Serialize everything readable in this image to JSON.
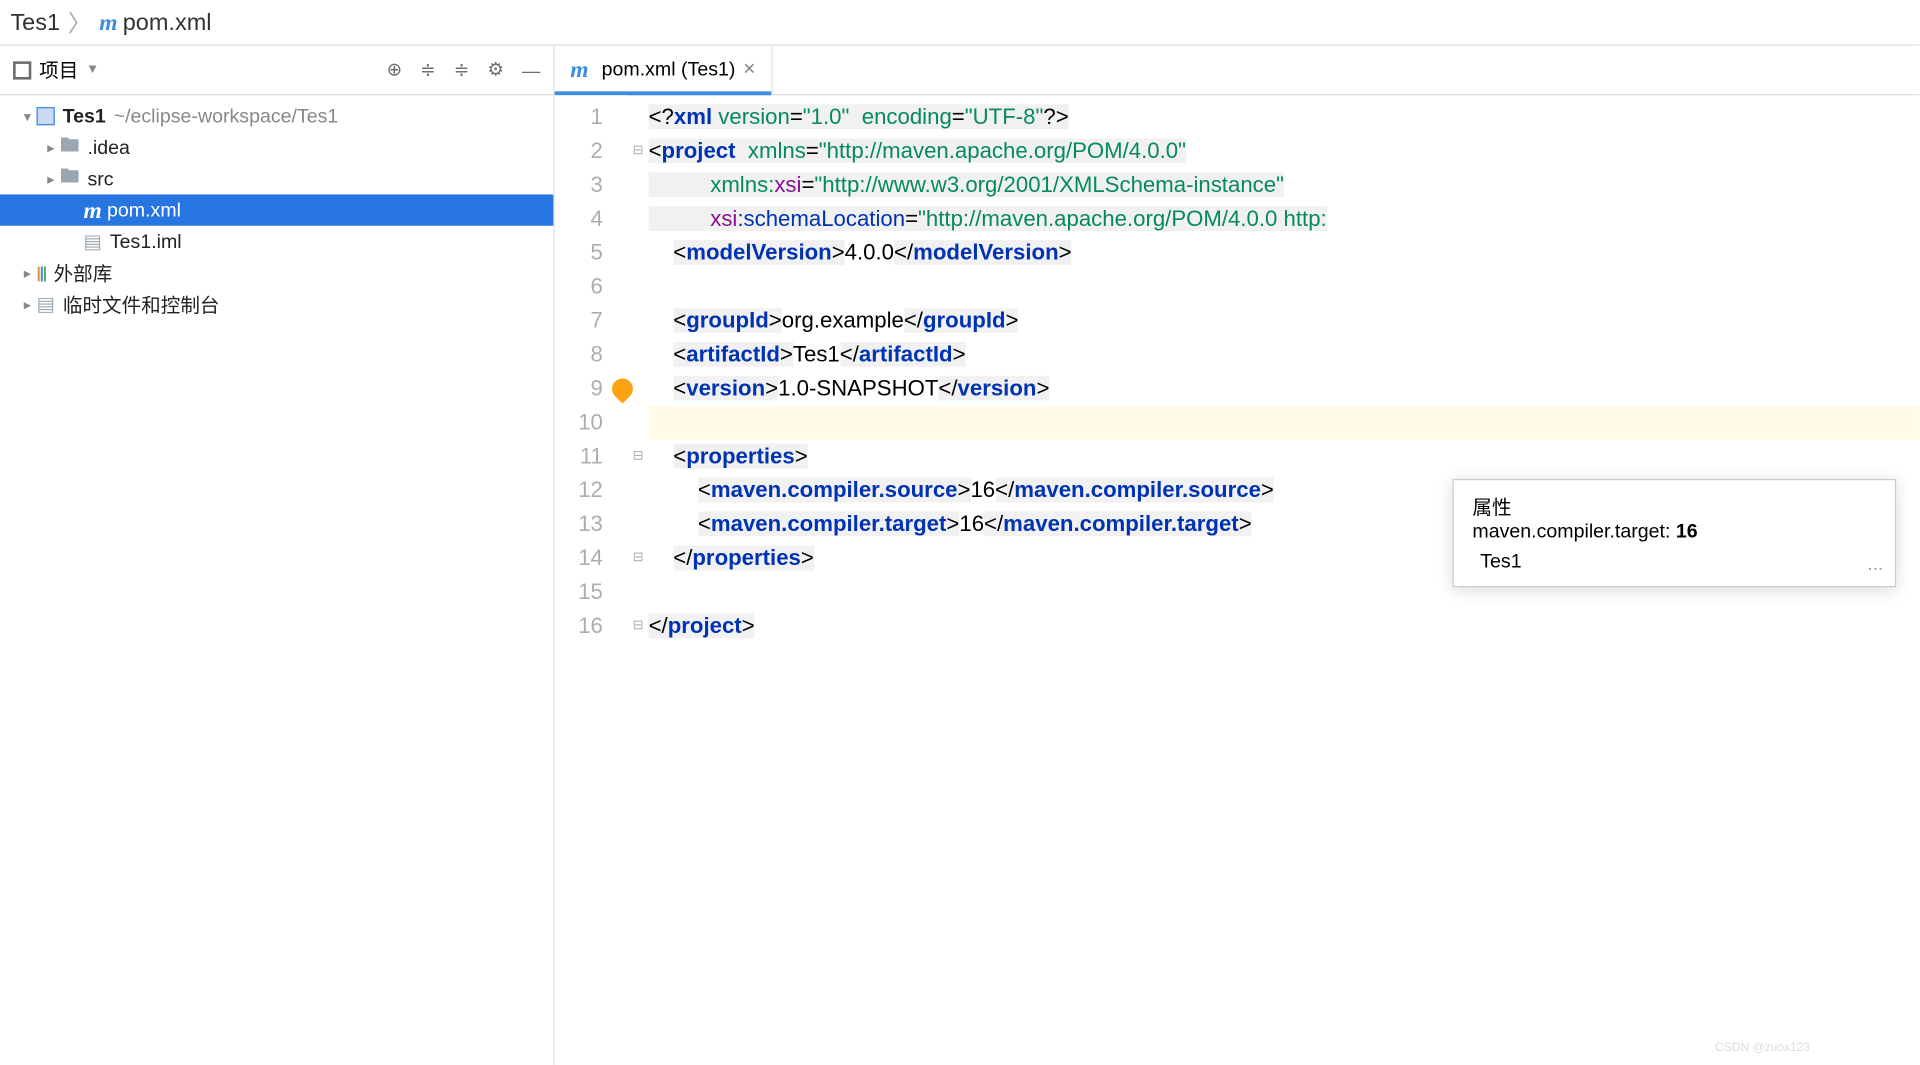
{
  "breadcrumb": {
    "project": "Tes1",
    "file": "pom.xml"
  },
  "sidebar": {
    "title": "项目",
    "tree": {
      "project": "Tes1",
      "project_path": "~/eclipse-workspace/Tes1",
      "idea": ".idea",
      "src": "src",
      "pom": "pom.xml",
      "iml": "Tes1.iml",
      "ext_lib": "外部库",
      "scratches": "临时文件和控制台"
    }
  },
  "tab": {
    "label": "pom.xml (Tes1)"
  },
  "code": {
    "xml_decl_open": "<?",
    "xml": "xml",
    "version_attr": "version",
    "version_val": "\"1.0\"",
    "encoding_attr": "encoding",
    "encoding_val": "\"UTF-8\"",
    "xml_decl_close": "?>",
    "project": "project",
    "xmlns_attr": "xmlns",
    "xmlns_val": "\"http://maven.apache.org/POM/4.0.0\"",
    "xsi_ns": "xmlns:",
    "xsi": "xsi",
    "xsi_val": "\"http://www.w3.org/2001/XMLSchema-instance\"",
    "xsi_pfx": "xsi",
    "schemaLoc": ":schemaLocation",
    "schemaLoc_val": "\"http://maven.apache.org/POM/4.0.0 http:",
    "modelVersion": "modelVersion",
    "modelVersion_v": "4.0.0",
    "groupId": "groupId",
    "groupId_v": "org.example",
    "artifactId": "artifactId",
    "artifactId_v": "Tes1",
    "version": "version",
    "version_v": "1.0-SNAPSHOT",
    "properties": "properties",
    "mcs": "maven.compiler.source",
    "mcs_v": "16",
    "mct": "maven.compiler.target",
    "mct_v": "16"
  },
  "gutter": [
    "1",
    "2",
    "3",
    "4",
    "5",
    "6",
    "7",
    "8",
    "9",
    "10",
    "11",
    "12",
    "13",
    "14",
    "15",
    "16"
  ],
  "popup": {
    "title": "属性",
    "prop": "maven.compiler.target: ",
    "value": "16",
    "path": "Tes1"
  },
  "watermark": "CSDN @zuox123"
}
